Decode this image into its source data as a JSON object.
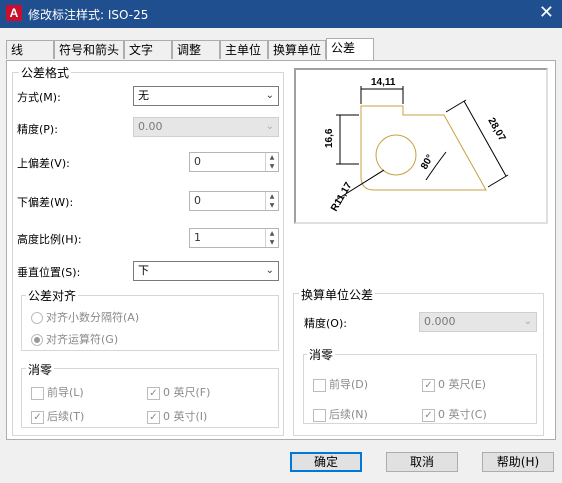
{
  "window": {
    "title": "修改标注样式: ISO-25",
    "app_icon": "A"
  },
  "tabs": [
    "线",
    "符号和箭头",
    "文字",
    "调整",
    "主单位",
    "换算单位",
    "公差"
  ],
  "tolerance_format": {
    "title": "公差格式",
    "method_label": "方式(M):",
    "method_value": "无",
    "precision_label": "精度(P):",
    "precision_value": "0.00",
    "upper_label": "上偏差(V):",
    "upper_value": "0",
    "lower_label": "下偏差(W):",
    "lower_value": "0",
    "height_label": "高度比例(H):",
    "height_value": "1",
    "vpos_label": "垂直位置(S):",
    "vpos_value": "下"
  },
  "tolerance_align": {
    "title": "公差对齐",
    "opt1": "对齐小数分隔符(A)",
    "opt2": "对齐运算符(G)"
  },
  "zero_suppress": {
    "title": "消零",
    "leading": "前导(L)",
    "feet": "0 英尺(F)",
    "trailing": "后续(T)",
    "inches": "0 英寸(I)"
  },
  "alt_unit_tol": {
    "title": "换算单位公差",
    "precision_label": "精度(O):",
    "precision_value": "0.000",
    "zero_title": "消零",
    "leading": "前导(D)",
    "feet": "0 英尺(E)",
    "trailing": "后续(N)",
    "inches": "0 英寸(C)"
  },
  "preview": {
    "dim_top": "14,11",
    "dim_left": "16,6",
    "dim_right": "28,07",
    "dim_angle": "80°",
    "dim_radius": "R11,17"
  },
  "buttons": {
    "ok": "确定",
    "cancel": "取消",
    "help": "帮助(H)"
  },
  "icons": {
    "close": "✕",
    "caret": "⌄"
  }
}
